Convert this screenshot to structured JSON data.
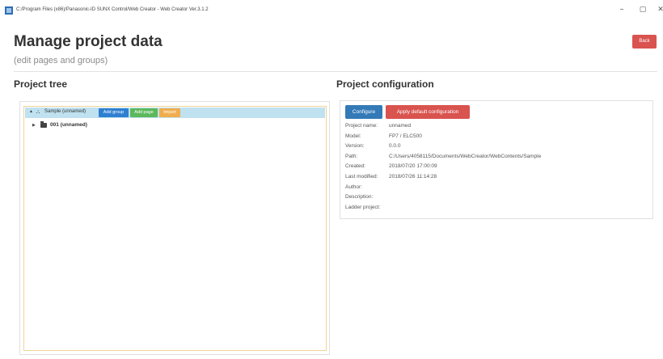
{
  "window": {
    "title": "C:/Program Files (x86)/Panasonic-ID SUNX Control/Web Creator - Web Creator Ver.3.1.2",
    "minimize": "–",
    "maximize": "▢",
    "close": "✕"
  },
  "header": {
    "title": "Manage project data",
    "subtitle": "(edit pages and groups)",
    "back_label": "Back"
  },
  "tree": {
    "section_title": "Project tree",
    "root": {
      "toggle": "▲",
      "label": "Sample (unnamed)",
      "buttons": {
        "add_group": "Add group",
        "add_page": "Add page",
        "import": "Import"
      }
    },
    "children": [
      {
        "toggle": "▶",
        "label": "001 (unnamed)"
      }
    ]
  },
  "config": {
    "section_title": "Project configuration",
    "configure_label": "Configure",
    "default_label": "Apply default configuration",
    "fields": [
      {
        "key": "Project name:",
        "value": "unnamed"
      },
      {
        "key": "Model:",
        "value": "FP7 / ELC500"
      },
      {
        "key": "Version:",
        "value": "0.0.0"
      },
      {
        "key": "Path:",
        "value": "C:/Users/4058115/Documents/WebCreator/WebContents/Sample"
      },
      {
        "key": "Created:",
        "value": "2018/07/20 17:00:09"
      },
      {
        "key": "Last modified:",
        "value": "2018/07/26 11:14:28"
      },
      {
        "key": "Author:",
        "value": ""
      },
      {
        "key": "Description:",
        "value": ""
      },
      {
        "key": "Ladder project:",
        "value": ""
      }
    ]
  },
  "colors": {
    "danger": "#d9534f",
    "primary": "#337ab7",
    "success": "#5cb85c",
    "warning": "#f0ad4e",
    "tree_selection": "#bfe1f0"
  }
}
